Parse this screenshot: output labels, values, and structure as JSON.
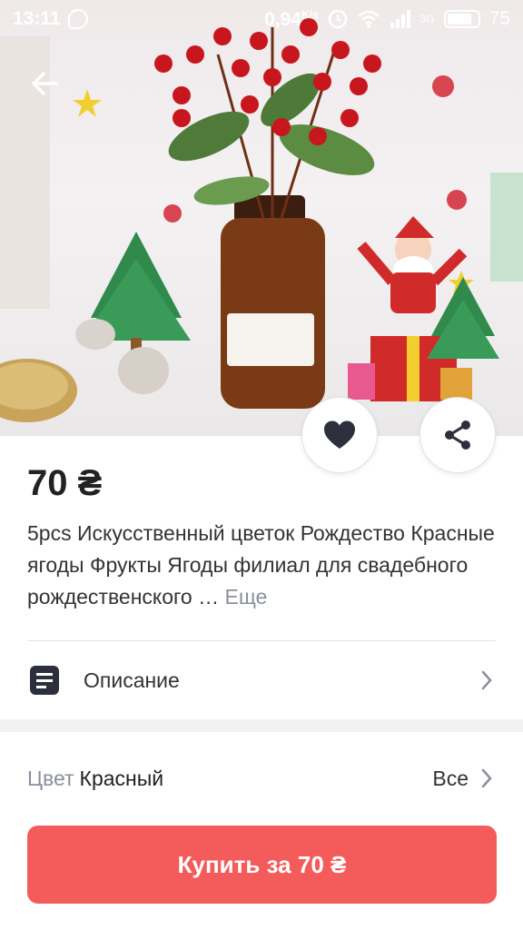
{
  "status_bar": {
    "time": "13:11",
    "speed": "0,94",
    "speed_unit": "K/s",
    "network": "3G",
    "battery": "75"
  },
  "product": {
    "price": "70 ₴",
    "title": "5pcs Искусственный цветок Рождество Красные ягоды Фрукты Ягоды филиал для свадебного рождественского …",
    "more_label": "Еще"
  },
  "description_row": {
    "label": "Описание"
  },
  "color_row": {
    "key": "Цвет",
    "value": "Красный",
    "all_label": "Все"
  },
  "buy_button": {
    "label": "Купить за 70 ₴"
  },
  "colors": {
    "accent": "#f45b5b",
    "muted_text": "#8a8f9c",
    "text": "#222222"
  }
}
